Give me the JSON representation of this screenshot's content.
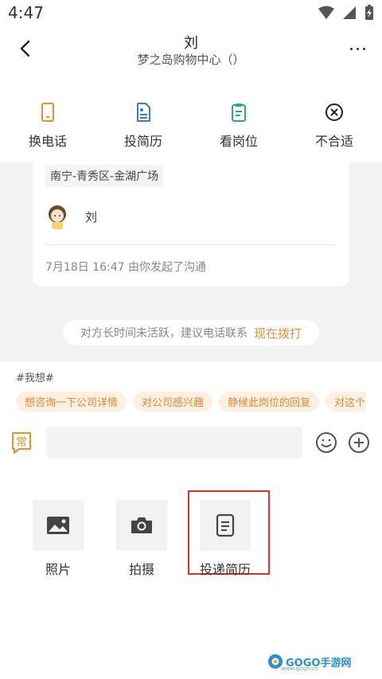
{
  "status_bar": {
    "time": "4:47"
  },
  "header": {
    "title": "刘",
    "subtitle": "梦之岛购物中心（）"
  },
  "actions": [
    {
      "label": "换电话",
      "icon": "phone-icon"
    },
    {
      "label": "投简历",
      "icon": "resume-icon"
    },
    {
      "label": "看岗位",
      "icon": "job-clipboard-icon"
    },
    {
      "label": "不合适",
      "icon": "reject-x-icon"
    }
  ],
  "card": {
    "location": "南宁-青秀区-金湖广场",
    "recruiter_name": "刘",
    "timestamp": "7月18日 16:47 由你发起了沟通"
  },
  "notice": {
    "text": "对方长时间未活跃，建议电话联系",
    "link": "现在拨打"
  },
  "quick_replies": {
    "tag": "#我想#",
    "chips": [
      "想咨询一下公司详情",
      "对公司感兴趣",
      "静候此岗位的回复",
      "对这个"
    ]
  },
  "input": {
    "placeholder": "",
    "phrase_label": "常"
  },
  "tools": [
    {
      "label": "照片",
      "icon": "image-icon"
    },
    {
      "label": "拍摄",
      "icon": "camera-icon"
    },
    {
      "label": "投递简历",
      "icon": "document-icon"
    }
  ],
  "watermark": {
    "text": "GOGO手游网",
    "sub": "www.gogo.cn"
  },
  "colors": {
    "accent": "#e6912e",
    "teal": "#2aa893",
    "blue": "#3a7bd5",
    "highlight": "#d9342b"
  }
}
